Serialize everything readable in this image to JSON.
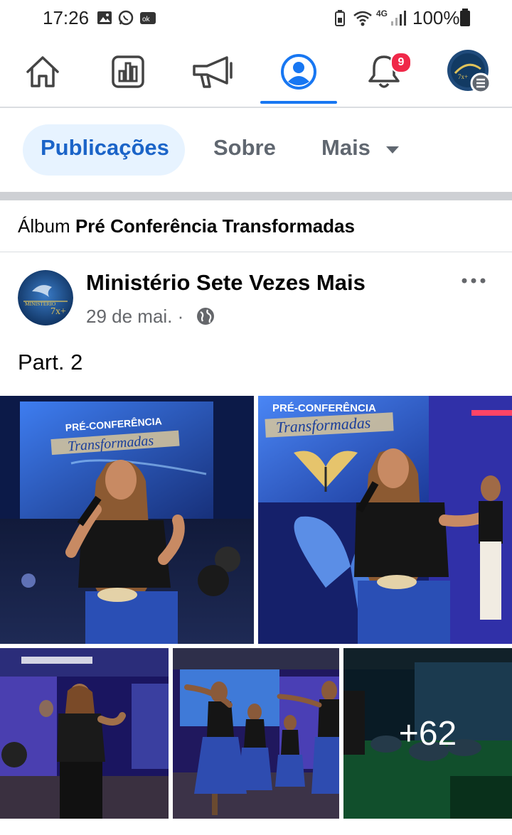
{
  "status_bar": {
    "time": "17:26",
    "network": "4G",
    "battery": "100%"
  },
  "nav": {
    "items": [
      {
        "name": "home",
        "icon": "home-icon"
      },
      {
        "name": "feeds",
        "icon": "feeds-icon"
      },
      {
        "name": "ads",
        "icon": "megaphone-icon"
      },
      {
        "name": "profile",
        "icon": "profile-icon",
        "active": true
      },
      {
        "name": "notifications",
        "icon": "bell-icon",
        "badge": "9"
      },
      {
        "name": "menu",
        "icon": "avatar-menu-icon"
      }
    ],
    "accent": "#1877f2"
  },
  "tabs": {
    "posts": "Publicações",
    "about": "Sobre",
    "more": "Mais"
  },
  "album": {
    "prefix": "Álbum",
    "name": "Pré Conferência Transformadas"
  },
  "post": {
    "author": "Ministério Sete Vezes Mais",
    "date": "29 de mai. ·",
    "text": "Part. 2",
    "more_photos": "+62",
    "photos": [
      {
        "alt": "Woman singing on stage in front of Pré-Conferência Transformadas screen"
      },
      {
        "alt": "Woman singing beside a blue butterfly decoration"
      },
      {
        "alt": "Singer with microphone on stage"
      },
      {
        "alt": "Dancers in blue skirts on stage"
      },
      {
        "alt": "Performers kneeling on stage"
      }
    ],
    "photo_banner_line1": "PRÉ-CONFERÊNCIA",
    "photo_banner_line2": "Transformadas",
    "avatar_text": "MINISTÉRIO 7x+"
  }
}
